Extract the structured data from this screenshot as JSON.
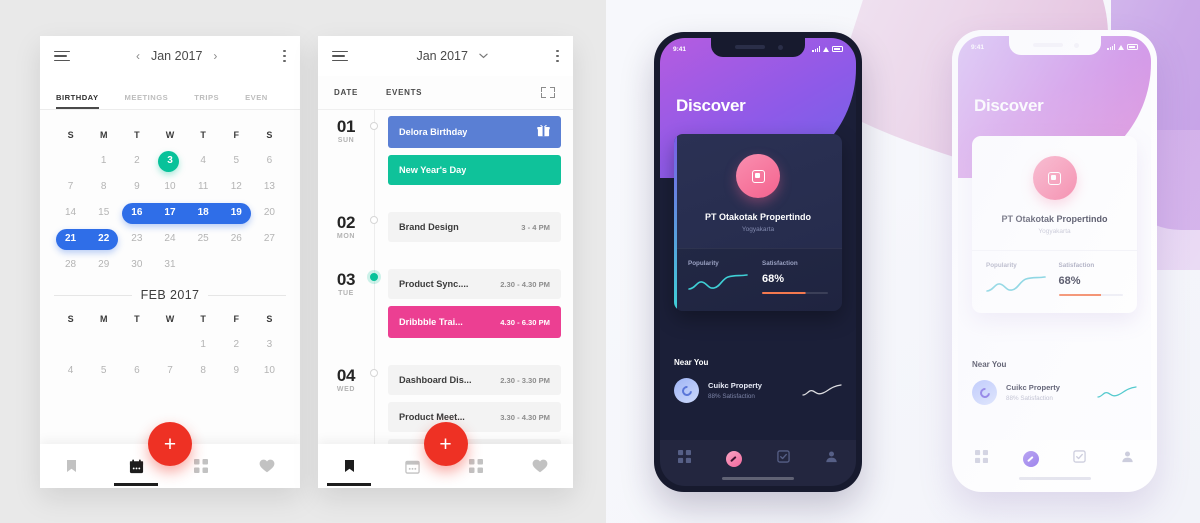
{
  "phone1": {
    "header": {
      "menu_icon": "hamburger-icon",
      "prev": "‹",
      "title": "Jan 2017",
      "next": "›",
      "more_icon": "kebab-icon"
    },
    "tabs": [
      {
        "label": "BIRTHDAY",
        "active": true
      },
      {
        "label": "MEETINGS",
        "active": false
      },
      {
        "label": "TRIPS",
        "active": false
      },
      {
        "label": "EVEN",
        "active": false
      }
    ],
    "dow": [
      "S",
      "M",
      "T",
      "W",
      "T",
      "F",
      "S"
    ],
    "weeks": [
      [
        "",
        "1",
        "2",
        "3",
        "4",
        "5",
        "6"
      ],
      [
        "7",
        "8",
        "9",
        "10",
        "11",
        "12",
        "13"
      ],
      [
        "14",
        "15",
        "16",
        "17",
        "18",
        "19",
        "20"
      ],
      [
        "21",
        "22",
        "23",
        "24",
        "25",
        "26",
        "27"
      ],
      [
        "28",
        "29",
        "30",
        "31",
        "",
        "",
        ""
      ]
    ],
    "today": "3",
    "selected_ranges": [
      [
        "16",
        "17",
        "18",
        "19"
      ],
      [
        "21",
        "22"
      ]
    ],
    "second_month": {
      "title": "FEB 2017",
      "dow": [
        "S",
        "M",
        "T",
        "W",
        "T",
        "F",
        "S"
      ],
      "weeks": [
        [
          "",
          "",
          "",
          "",
          "1",
          "2",
          "3"
        ],
        [
          "4",
          "5",
          "6",
          "7",
          "8",
          "9",
          "10"
        ]
      ]
    },
    "fab_label": "+",
    "nav": [
      {
        "icon": "bookmark-icon",
        "active": false
      },
      {
        "icon": "calendar-icon",
        "active": true
      },
      {
        "icon": "grid-icon",
        "active": false
      },
      {
        "icon": "heart-icon",
        "active": false
      }
    ],
    "colors": {
      "today": "#08c29a",
      "selected": "#2f6ee8",
      "fab": "#ee3124"
    }
  },
  "phone2": {
    "header": {
      "menu_icon": "hamburger-icon",
      "title": "Jan 2017",
      "chevron": "⌄",
      "more_icon": "kebab-icon"
    },
    "columns": {
      "date": "DATE",
      "events": "EVENTS",
      "expand_icon": "expand-icon"
    },
    "days": [
      {
        "num": "01",
        "wd": "SUN",
        "marked": false,
        "events": [
          {
            "name": "Delora Birthday",
            "time": "",
            "style": "blue",
            "icon": "gift-icon"
          },
          {
            "name": "New Year's Day",
            "time": "",
            "style": "teal",
            "icon": ""
          }
        ]
      },
      {
        "num": "02",
        "wd": "MON",
        "marked": false,
        "events": [
          {
            "name": "Brand Design",
            "time": "3 - 4 PM",
            "style": "plain",
            "icon": ""
          }
        ]
      },
      {
        "num": "03",
        "wd": "TUE",
        "marked": true,
        "events": [
          {
            "name": "Product Sync....",
            "time": "2.30 - 4.30 PM",
            "style": "plain",
            "icon": ""
          },
          {
            "name": "Dribbble Trai...",
            "time": "4.30 - 6.30 PM",
            "style": "pink",
            "icon": ""
          }
        ]
      },
      {
        "num": "04",
        "wd": "WED",
        "marked": false,
        "events": [
          {
            "name": "Dashboard Dis...",
            "time": "2.30 - 3.30 PM",
            "style": "plain",
            "icon": ""
          },
          {
            "name": "Product Meet...",
            "time": "3.30 - 4.30 PM",
            "style": "plain",
            "icon": ""
          }
        ]
      }
    ],
    "fab_label": "+",
    "nav": [
      {
        "icon": "bookmark-icon",
        "active": true
      },
      {
        "icon": "calendar-icon",
        "active": false
      },
      {
        "icon": "grid-icon",
        "active": false
      },
      {
        "icon": "heart-icon",
        "active": false
      }
    ],
    "colors": {
      "blue": "#5a7fd4",
      "teal": "#0fc29a",
      "pink": "#ec3f92",
      "plain": "#f3f3f3"
    }
  },
  "phone3": {
    "status": {
      "time": "9:41",
      "signal_icon": "signal-icon",
      "wifi_icon": "wifi-icon",
      "battery_icon": "battery-icon"
    },
    "title": "Discover",
    "card": {
      "avatar_icon": "property-icon",
      "name": "PT Otakotak Propertindo",
      "location": "Yogyakarta",
      "stats": [
        {
          "label": "Popularity",
          "type": "sparkline"
        },
        {
          "label": "Satisfaction",
          "value": "68%",
          "type": "bar"
        }
      ]
    },
    "near": {
      "title": "Near You",
      "item": {
        "avatar_icon": "company-icon",
        "name": "Cuikc Property",
        "sub": "88% Satisfaction",
        "spark_icon": "sparkline-icon"
      }
    },
    "nav": [
      {
        "icon": "grid-icon",
        "active": false
      },
      {
        "icon": "compass-icon",
        "active": true
      },
      {
        "icon": "tasks-icon",
        "active": false
      },
      {
        "icon": "person-icon",
        "active": false
      }
    ],
    "colors": {
      "accent": "#f2689c",
      "bg": "#1b1f38",
      "hero_start": "#b55ce0",
      "hero_end": "#6f63e8"
    }
  },
  "phone4": {
    "status": {
      "time": "9:41",
      "signal_icon": "signal-icon",
      "wifi_icon": "wifi-icon",
      "battery_icon": "battery-icon"
    },
    "title": "Discover",
    "card": {
      "avatar_icon": "property-icon",
      "name": "PT Otakotak Propertindo",
      "location": "Yogyakarta",
      "stats": [
        {
          "label": "Popularity",
          "type": "sparkline"
        },
        {
          "label": "Satisfaction",
          "value": "68%",
          "type": "bar"
        }
      ]
    },
    "near": {
      "title": "Near You",
      "item": {
        "avatar_icon": "company-icon",
        "name": "Cuikc Property",
        "sub": "88% Satisfaction",
        "spark_icon": "sparkline-icon"
      }
    },
    "nav": [
      {
        "icon": "grid-icon",
        "active": false
      },
      {
        "icon": "compass-icon",
        "active": true
      },
      {
        "icon": "tasks-icon",
        "active": false
      },
      {
        "icon": "person-icon",
        "active": false
      }
    ],
    "colors": {
      "accent": "#8c6ee8",
      "bg": "#fdfdff",
      "hero_start": "#a96ce6",
      "hero_end": "#e088d2"
    }
  }
}
